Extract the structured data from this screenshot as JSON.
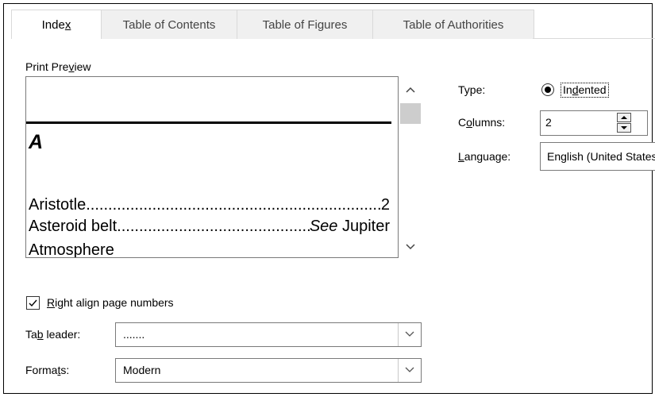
{
  "tabs": [
    {
      "pre": "Inde",
      "key": "x",
      "post": ""
    },
    {
      "pre": "Table of Contents",
      "key": "",
      "post": ""
    },
    {
      "pre": "Table of Figures",
      "key": "",
      "post": ""
    },
    {
      "pre": "Table of Authorities",
      "key": "",
      "post": ""
    }
  ],
  "print_preview": {
    "label_pre": "Print Pre",
    "label_key": "v",
    "label_post": "iew",
    "heading_letter": "A",
    "entries": [
      {
        "name": "Aristotle ",
        "page": "2",
        "see": ""
      },
      {
        "name": "Asteroid belt",
        "page": " Jupiter",
        "see": " See"
      },
      {
        "name": "Atmosphere",
        "page": "",
        "see": ""
      }
    ],
    "scroll_up_icon": "chevron-up-icon",
    "scroll_down_icon": "chevron-down-icon"
  },
  "type": {
    "label": "Type:",
    "option_pre": "In",
    "option_key": "d",
    "option_post": "ented",
    "selected": true
  },
  "columns": {
    "label_pre": "C",
    "label_key": "o",
    "label_post": "lumns:",
    "value": "2"
  },
  "language": {
    "label_pre": "",
    "label_key": "L",
    "label_post": "anguage:",
    "value": "English (United States)"
  },
  "right_align": {
    "label_pre": "",
    "label_key": "R",
    "label_post": "ight align page numbers",
    "checked": true
  },
  "tab_leader": {
    "label_pre": "Ta",
    "label_key": "b",
    "label_post": " leader:",
    "value": "......."
  },
  "formats": {
    "label_pre": "Forma",
    "label_key": "t",
    "label_post": "s:",
    "value": "Modern"
  },
  "colors": {
    "tab_border": "#d9d9d9",
    "field_border": "#7a7a7a",
    "scroll_thumb": "#cdcdcd"
  }
}
